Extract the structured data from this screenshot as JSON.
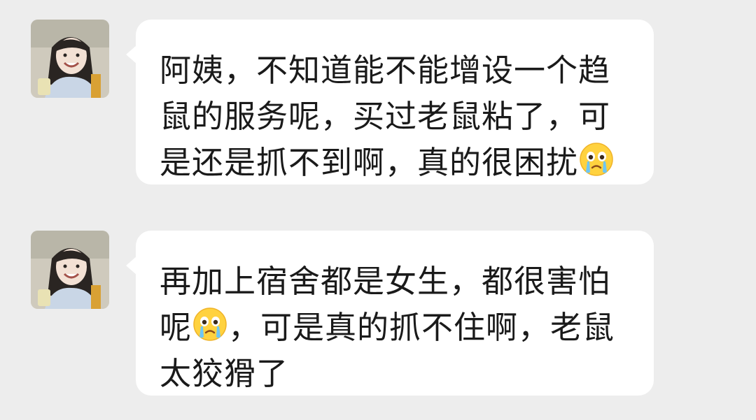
{
  "messages": [
    {
      "parts": [
        "阿姨，不知道能不能增设一个趋\n鼠的服务呢，买过老鼠粘了，可\n是还是抓不到啊，真的很困扰"
      ],
      "trailing_emoji": "crying-face-emoji",
      "avatar_icon": "user-avatar-girl"
    },
    {
      "parts": [
        "再加上宿舍都是女生，都很害怕\n呢",
        "，可是真的抓不住啊，老鼠\n太狡猾了"
      ],
      "inline_emoji": "crying-face-emoji",
      "avatar_icon": "user-avatar-girl"
    }
  ],
  "colors": {
    "background": "#ededed",
    "bubble": "#ffffff",
    "text": "#1a1a1a"
  }
}
